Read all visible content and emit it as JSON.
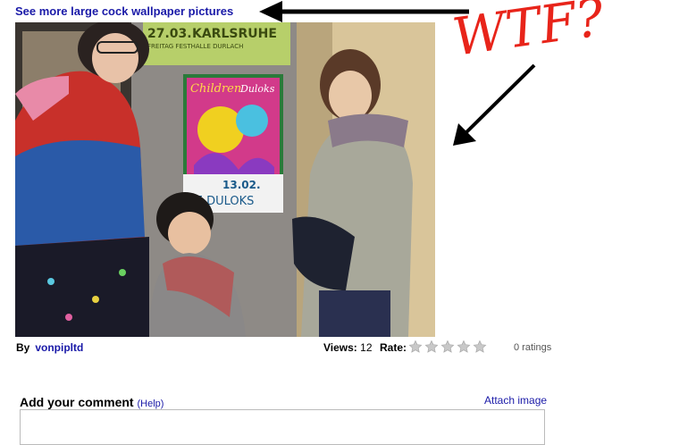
{
  "top_link": "See more large cock wallpaper pictures",
  "photo": {
    "poster_date_top": "27.03.",
    "poster_city": "KARLSRUHE",
    "poster_sub": "FREITAG  FESTHALLE DURLACH",
    "poster_title_a": "Children",
    "poster_title_b": "Duloks",
    "poster_date_bottom": "13.02.",
    "poster_band": "HE DULOKS"
  },
  "byline": {
    "prefix": "By",
    "user": "vonpipltd"
  },
  "stats": {
    "views_label": "Views:",
    "views_count": "12",
    "rate_label": "Rate:",
    "ratings": "0 ratings"
  },
  "comment": {
    "title": "Add your comment",
    "help": "(Help)",
    "attach": "Attach image",
    "value": ""
  },
  "annotation": {
    "text": "WTF?",
    "color": "#e8241a"
  },
  "colors": {
    "link": "#1a1aa8",
    "star": "#c8c8c8"
  }
}
